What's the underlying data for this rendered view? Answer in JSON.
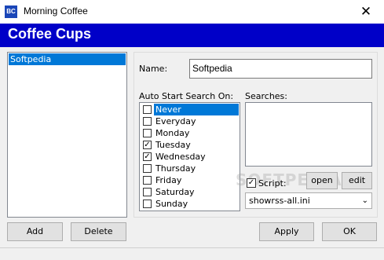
{
  "window": {
    "title": "Morning Coffee",
    "icon_text": "BC"
  },
  "banner": {
    "title": "Coffee Cups"
  },
  "cups": {
    "items": [
      "Softpedia"
    ]
  },
  "buttons": {
    "add": "Add",
    "delete": "Delete",
    "apply": "Apply",
    "ok": "OK",
    "open": "open",
    "edit": "edit"
  },
  "form": {
    "name_label": "Name:",
    "name_value": "Softpedia",
    "auto_start_label": "Auto Start Search On:",
    "searches_label": "Searches:",
    "script_label": "Script:",
    "script_checked": true,
    "script_value": "showrss-all.ini"
  },
  "days": [
    {
      "label": "Never",
      "checked": false,
      "selected": true
    },
    {
      "label": "Everyday",
      "checked": false,
      "selected": false
    },
    {
      "label": "Monday",
      "checked": false,
      "selected": false
    },
    {
      "label": "Tuesday",
      "checked": true,
      "selected": false
    },
    {
      "label": "Wednesday",
      "checked": true,
      "selected": false
    },
    {
      "label": "Thursday",
      "checked": false,
      "selected": false
    },
    {
      "label": "Friday",
      "checked": false,
      "selected": false
    },
    {
      "label": "Saturday",
      "checked": false,
      "selected": false
    },
    {
      "label": "Sunday",
      "checked": false,
      "selected": false
    }
  ],
  "watermark": "SOFTPEDIA"
}
